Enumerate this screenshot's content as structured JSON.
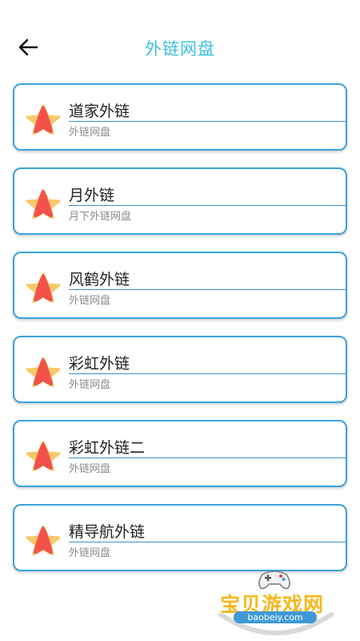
{
  "header": {
    "title": "外链网盘",
    "back_icon": "arrow-left-icon"
  },
  "items": [
    {
      "name": "道家外链",
      "subtitle": "外链网盘",
      "icon": "star-icon"
    },
    {
      "name": "月外链",
      "subtitle": "月下外链网盘",
      "icon": "star-icon"
    },
    {
      "name": "风鹤外链",
      "subtitle": "外链网盘",
      "icon": "star-icon"
    },
    {
      "name": "彩虹外链",
      "subtitle": "外链网盘",
      "icon": "star-icon"
    },
    {
      "name": "彩虹外链二",
      "subtitle": "外链网盘",
      "icon": "star-icon"
    },
    {
      "name": "精导航外链",
      "subtitle": "外链网盘",
      "icon": "star-icon"
    }
  ],
  "watermark": {
    "text": "宝贝游戏网",
    "url": "baobeiy.com"
  },
  "colors": {
    "title": "#3cc0e0",
    "card_border": "#3ba3dc",
    "star_front": "#f2524a",
    "star_back": "#f8c86a"
  }
}
